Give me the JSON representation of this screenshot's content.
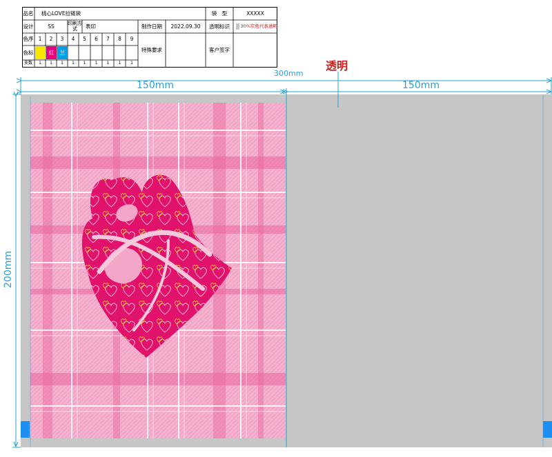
{
  "spec_table": {
    "pinming_label": "品名",
    "pinming_value": "桃心LOVE拉链袋",
    "daixing_label": "袋　型",
    "daixing_value": "XXXXX",
    "sheji_label": "设计",
    "sheji_value": "SS",
    "yinshua_label": "印刷方式",
    "yinshua_value": "表印",
    "zhizuo_label": "制作日期",
    "zhizuo_value": "2022.09.30",
    "touming_label": "透明标识",
    "touming_value": "30%灰色代表透明",
    "sexu_label": "色序",
    "sexu_numbers": [
      "1",
      "2",
      "3",
      "4",
      "5",
      "6",
      "7",
      "8",
      "9"
    ],
    "sebiao_label": "色标",
    "sebiao_swatches": [
      {
        "text": "",
        "color": "#f7e600",
        "text_color": "#000000"
      },
      {
        "text": "红",
        "color": "#e5007f",
        "text_color": "#ffffff"
      },
      {
        "text": "兰",
        "color": "#00a0e9",
        "text_color": "#ffffff"
      }
    ],
    "teshu_label": "特殊要求",
    "kehu_label": "客户签字",
    "zhishu_label": "支数",
    "zhishu_values": [
      "1",
      "1",
      "1",
      "1",
      "1",
      "1",
      "1",
      "1",
      "1"
    ]
  },
  "dimensions": {
    "total_width": "300mm",
    "left_width": "150mm",
    "right_width": "150mm",
    "height": "200mm",
    "transparent_label": "透明"
  },
  "colors": {
    "dimension_line": "#2a9fd6",
    "transparent_label": "#cc1f1f",
    "panel_gray": "#c6c6c6",
    "plaid_base": "#f3a6c8",
    "heart_magenta": "#e0126b",
    "tab_blue": "#1e8ff2"
  }
}
